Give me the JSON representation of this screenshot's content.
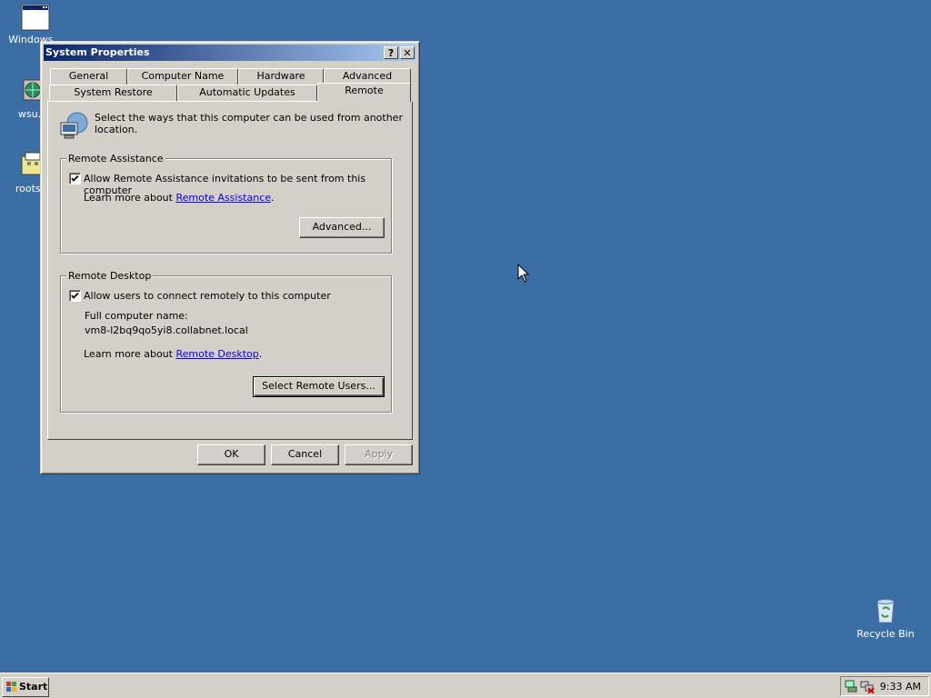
{
  "desktop": {
    "icons": [
      {
        "label": "Windows..."
      },
      {
        "label": "wsu..."
      },
      {
        "label": "roots..."
      },
      {
        "label": "Recycle Bin"
      }
    ]
  },
  "window": {
    "title": "System Properties",
    "help_button": "?",
    "close_button": "✕",
    "tabs_row1": [
      "General",
      "Computer Name",
      "Hardware",
      "Advanced"
    ],
    "tabs_row2": [
      "System Restore",
      "Automatic Updates",
      "Remote"
    ],
    "active_tab": "Remote",
    "intro_line1": "Select the ways that this computer can be used from another",
    "intro_line2": "location.",
    "remote_assistance": {
      "title": "Remote Assistance",
      "checkbox_label": "Allow Remote Assistance invitations to be sent from this computer",
      "checked": true,
      "learn_prefix": "Learn more about ",
      "learn_link": "Remote Assistance",
      "learn_suffix": ".",
      "advanced_button": "Advanced..."
    },
    "remote_desktop": {
      "title": "Remote Desktop",
      "checkbox_label": "Allow users to connect remotely to this computer",
      "checked": true,
      "computer_name_label": "Full computer name:",
      "computer_name_value": "vm8-l2bq9qo5yi8.collabnet.local",
      "learn_prefix": "Learn more about ",
      "learn_link": "Remote Desktop",
      "learn_suffix": ".",
      "select_users_button": "Select Remote Users..."
    },
    "ok_button": "OK",
    "cancel_button": "Cancel",
    "apply_button": "Apply"
  },
  "taskbar": {
    "start_label": "Start",
    "clock": "9:33 AM"
  },
  "colors": {
    "desktop": "#3a6ea5",
    "title_start": "#0a246a",
    "title_end": "#a6caf0",
    "face": "#d4d0c8"
  }
}
